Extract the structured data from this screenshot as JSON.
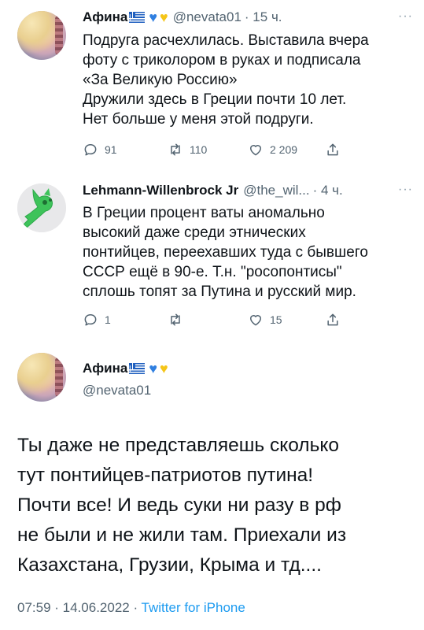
{
  "tweet1": {
    "name": "Афина",
    "handle": "@nevata01",
    "time": "· 15 ч.",
    "lines": [
      "Подруга расчехлилась. Выставила вчера",
      "фоту с триколором в руках и подписала",
      "«За Великую Россию»",
      "Дружили здесь в Греции почти 10 лет.",
      "Нет больше у меня этой подруги."
    ],
    "replies": "91",
    "retweets": "110",
    "likes": "2 209",
    "more": "···"
  },
  "tweet2": {
    "name": "Lehmann-Willenbrock Jr",
    "handle": "@the_wil...",
    "time": "· 4 ч.",
    "lines": [
      "В Греции процент ваты аномально",
      "высокий даже среди этнических",
      "понтийцев, переехавших туда с бывшего",
      "СССР ещё в 90-е. Т.н. \"росопонтисы\"",
      "сплошь топят за Путина и русский мир."
    ],
    "replies": "1",
    "retweets": "",
    "likes": "15",
    "more": "···"
  },
  "tweet3": {
    "name": "Афина",
    "handle": "@nevata01",
    "lines": [
      "Ты даже не представляешь сколько",
      "тут понтийцев-патриотов путина!",
      "Почти все! И ведь суки ни разу в рф",
      "не были и не жили там. Приехали из",
      "Казахстана, Грузии, Крыма и тд...."
    ],
    "timestamp": "07:59 · 14.06.2022 · ",
    "source": "Twitter for iPhone"
  },
  "icons": {
    "reply": "reply-icon",
    "retweet": "retweet-icon",
    "like": "like-icon",
    "share": "share-icon",
    "flag": "greece-flag-icon",
    "heart_blue": "blue-heart-icon",
    "heart_yellow": "yellow-heart-icon"
  },
  "colors": {
    "text": "#0f1419",
    "secondary": "#536471",
    "link": "#1d9bf0",
    "heart_blue": "#2f7fe0",
    "heart_yellow": "#f5c518"
  }
}
